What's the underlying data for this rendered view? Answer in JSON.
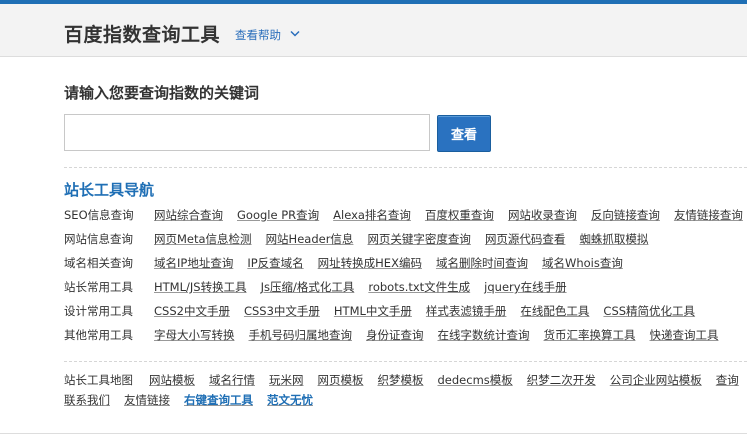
{
  "header": {
    "title": "百度指数查询工具",
    "help_label": "查看帮助"
  },
  "search": {
    "prompt": "请输入您要查询指数的关键词",
    "input_value": "",
    "button_label": "查看"
  },
  "nav": {
    "title": "站长工具导航",
    "rows": [
      {
        "label": "SEO信息查询",
        "links": [
          "网站综合查询",
          "Google PR查询",
          "Alexa排名查询",
          "百度权重查询",
          "网站收录查询",
          "反向链接查询",
          "友情链接查询"
        ]
      },
      {
        "label": "网站信息查询",
        "links": [
          "网页Meta信息检测",
          "网站Header信息",
          "网页关键字密度查询",
          "网页源代码查看",
          "蜘蛛抓取模拟"
        ]
      },
      {
        "label": "域名相关查询",
        "links": [
          "域名IP地址查询",
          "IP反查域名",
          "网址转换成HEX编码",
          "域名删除时间查询",
          "域名Whois查询"
        ]
      },
      {
        "label": "站长常用工具",
        "links": [
          "HTML/JS转换工具",
          "Js压缩/格式化工具",
          "robots.txt文件生成",
          "jquery在线手册"
        ]
      },
      {
        "label": "设计常用工具",
        "links": [
          "CSS2中文手册",
          "CSS3中文手册",
          "HTML中文手册",
          "样式表滤镜手册",
          "在线配色工具",
          "CSS精简优化工具"
        ]
      },
      {
        "label": "其他常用工具",
        "links": [
          "字母大小写转换",
          "手机号码归属地查询",
          "身份证查询",
          "在线字数统计查询",
          "货币汇率换算工具",
          "快递查询工具"
        ]
      }
    ]
  },
  "footer": {
    "map_label": "站长工具地图",
    "row1": [
      "网站模板",
      "域名行情",
      "玩米网",
      "网页模板",
      "织梦模板",
      "dedecms模板",
      "织梦二次开发",
      "公司企业网站模板",
      "查询"
    ],
    "row2": [
      {
        "text": "联系我们",
        "highlight": false
      },
      {
        "text": "友情链接",
        "highlight": false
      },
      {
        "text": "右键查询工具",
        "highlight": true
      },
      {
        "text": "范文无忧",
        "highlight": true
      }
    ]
  },
  "colors": {
    "accent": "#1f6fb5",
    "button": "#2a72c0",
    "header_bg": "#f3f3f3"
  }
}
